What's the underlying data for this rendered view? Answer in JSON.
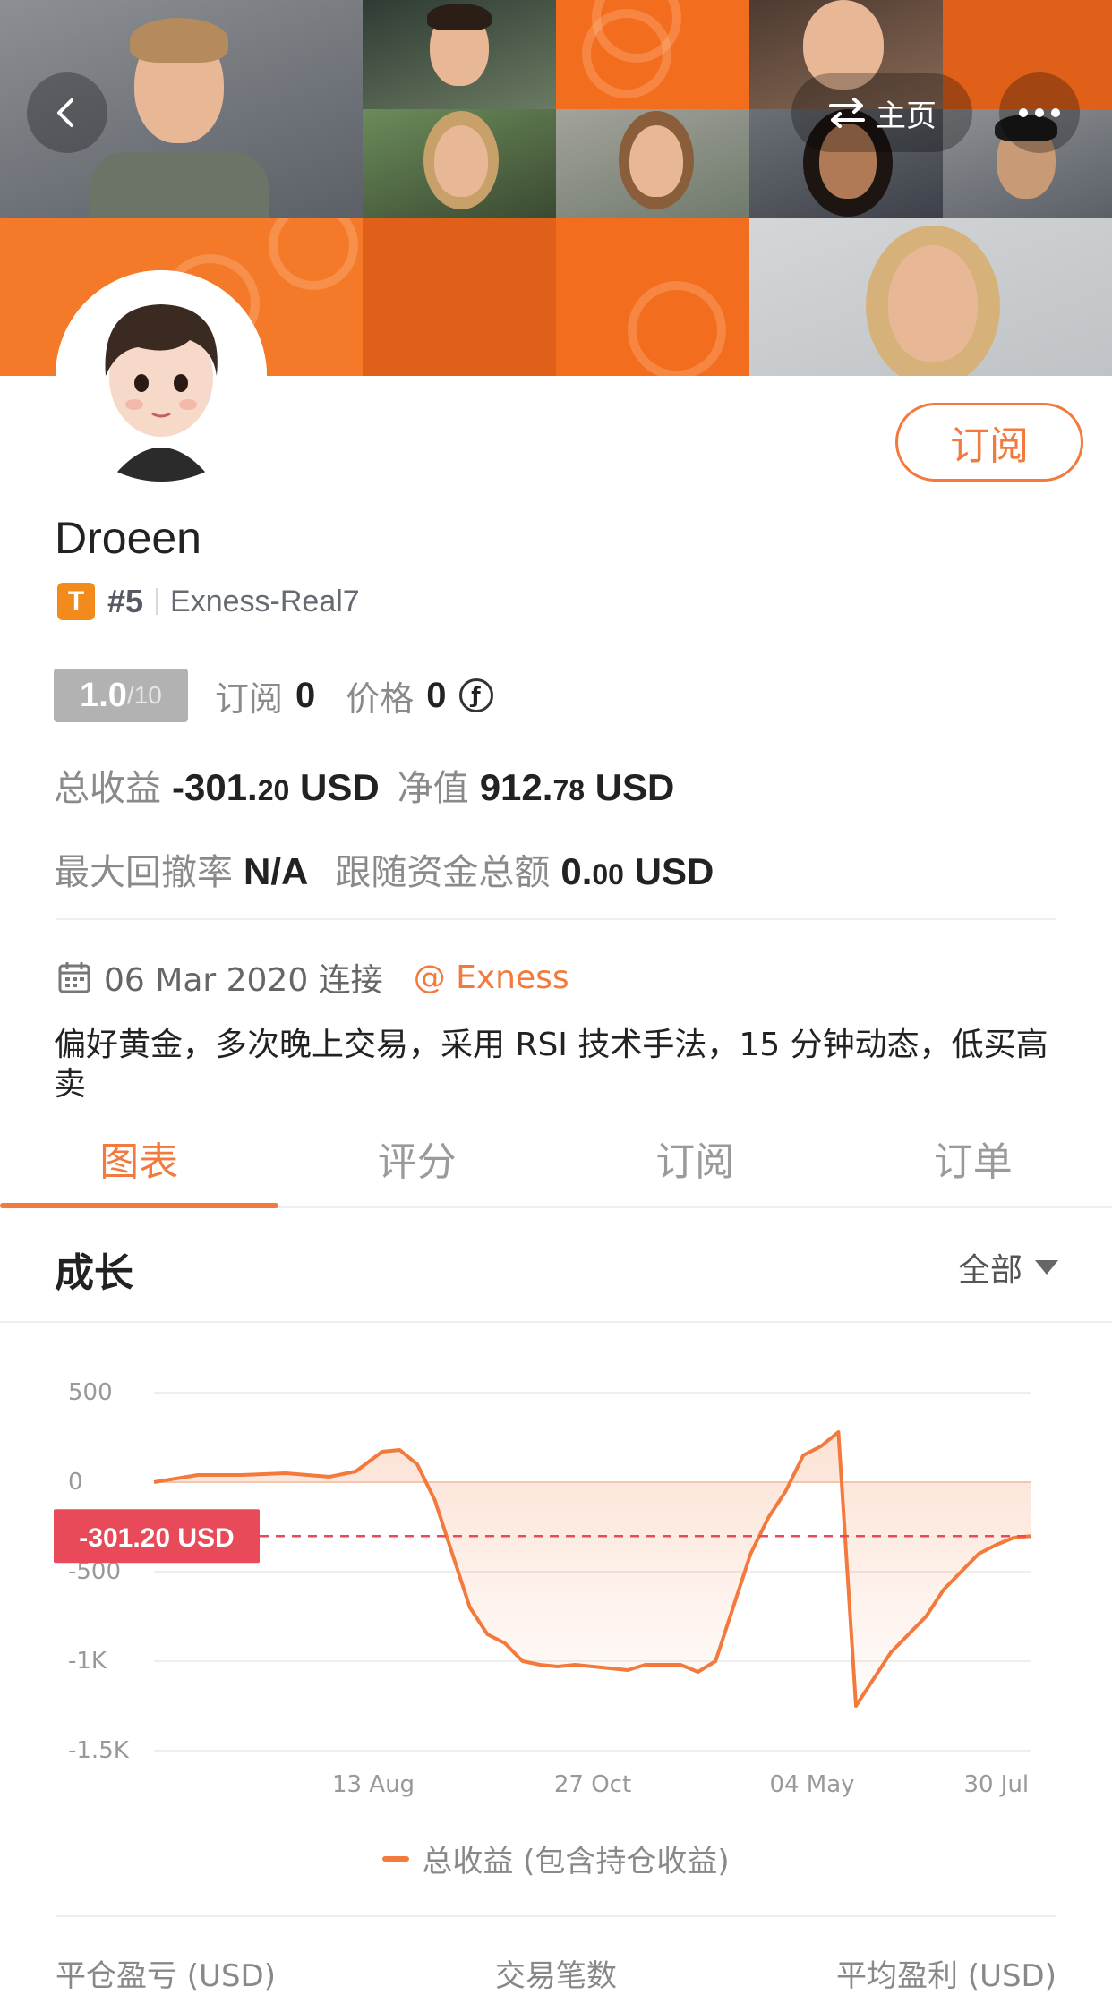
{
  "header": {
    "home_label": "主页",
    "subscribe_label": "订阅"
  },
  "profile": {
    "name": "Droeen",
    "badge_letter": "T",
    "rank": "#5",
    "account": "Exness-Real7",
    "score_value": "1.0",
    "score_denominator": "/10",
    "subscriptions_label": "订阅",
    "subscriptions_value": "0",
    "price_label": "价格",
    "price_value": "0",
    "total_profit_label": "总收益",
    "total_profit_int": "-301.",
    "total_profit_dec": "20",
    "total_profit_unit": "USD",
    "equity_label": "净值",
    "equity_int": "912.",
    "equity_dec": "78",
    "equity_unit": "USD",
    "max_drawdown_label": "最大回撤率",
    "max_drawdown_value": "N/A",
    "follow_funds_label": "跟随资金总额",
    "follow_funds_int": "0.",
    "follow_funds_dec": "00",
    "follow_funds_unit": "USD",
    "connected_date": "06 Mar 2020 连接",
    "broker": "@ Exness",
    "bio": "偏好黄金，多次晚上交易，采用 RSI 技术手法，15 分钟动态，低买高卖"
  },
  "tabs": [
    {
      "label": "图表",
      "active": true
    },
    {
      "label": "评分",
      "active": false
    },
    {
      "label": "订阅",
      "active": false
    },
    {
      "label": "订单",
      "active": false
    }
  ],
  "growth": {
    "title": "成长",
    "range_label": "全部"
  },
  "chart_data": {
    "type": "area",
    "title": "",
    "series": [
      {
        "name": "总收益 (包含持仓收益)",
        "x": [
          0,
          5,
          10,
          15,
          20,
          23,
          26,
          28,
          30,
          32,
          34,
          36,
          38,
          40,
          42,
          44,
          46,
          48,
          50,
          52,
          54,
          56,
          58,
          60,
          62,
          64,
          66,
          68,
          70,
          72,
          74,
          76,
          78,
          80,
          82,
          84,
          86,
          88,
          90,
          92,
          94,
          96,
          98,
          100
        ],
        "values": [
          0,
          40,
          40,
          50,
          30,
          60,
          170,
          180,
          100,
          -100,
          -400,
          -700,
          -850,
          -900,
          -1000,
          -1020,
          -1030,
          -1020,
          -1030,
          -1040,
          -1050,
          -1020,
          -1020,
          -1020,
          -1060,
          -1000,
          -700,
          -400,
          -200,
          -50,
          150,
          200,
          280,
          -1250,
          -1100,
          -950,
          -850,
          -750,
          -600,
          -500,
          -400,
          -350,
          -310,
          -301.2
        ]
      }
    ],
    "x_tick_labels": [
      "13 Aug",
      "27 Oct",
      "04 May",
      "30 Jul"
    ],
    "x_tick_positions": [
      25,
      50,
      75,
      96
    ],
    "y_tick_labels": [
      "500",
      "0",
      "-500",
      "-1K",
      "-1.5K"
    ],
    "y_tick_values": [
      500,
      0,
      -500,
      -1000,
      -1500
    ],
    "ylim": [
      -1500,
      500
    ],
    "current_value": -301.2,
    "current_label": "-301.20 USD",
    "grid": true,
    "legend_position": "bottom",
    "line_color": "#f27a3d",
    "marker_color": "#e84a5a"
  },
  "legend_label": "总收益 (包含持仓收益)",
  "footer_columns": [
    "平仓盈亏 (USD)",
    "交易笔数",
    "平均盈利 (USD)"
  ]
}
